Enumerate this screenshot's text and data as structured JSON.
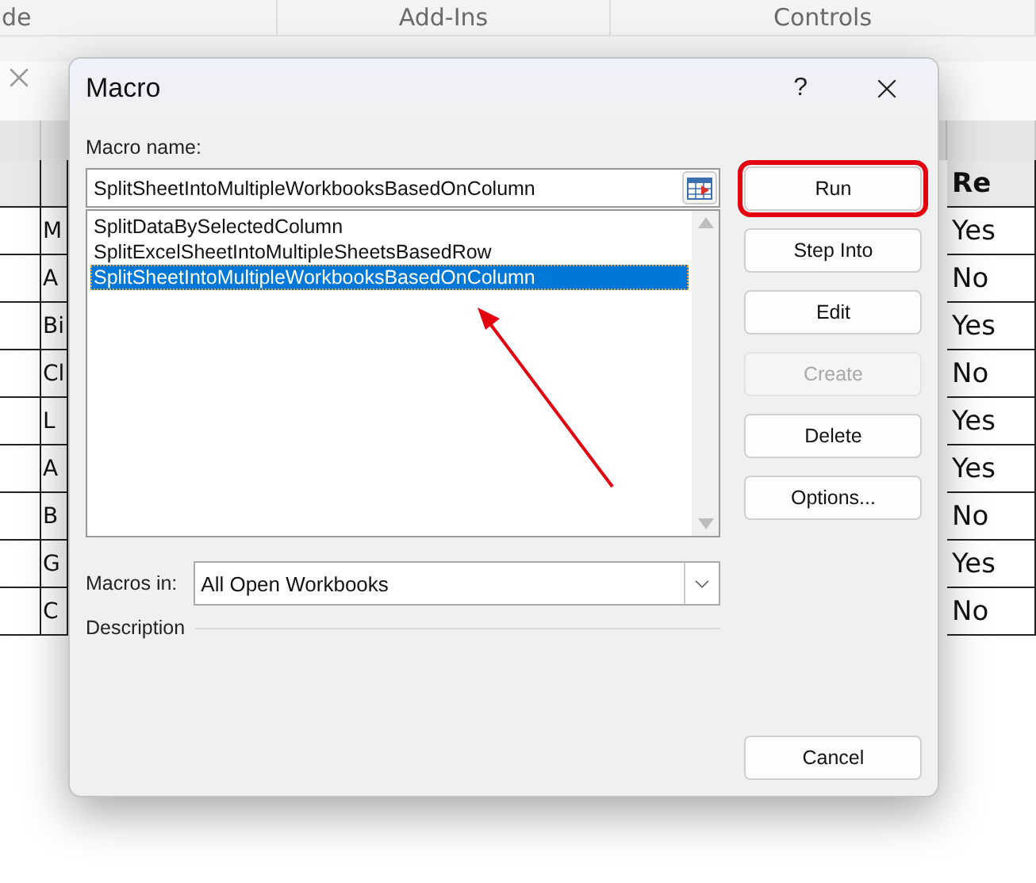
{
  "ribbon": {
    "groups": [
      "de",
      "Add-Ins",
      "Controls"
    ]
  },
  "sheet": {
    "header": {
      "column_2": "Re"
    },
    "rows": [
      {
        "column_1": "M",
        "column_2": "Yes"
      },
      {
        "column_1": "A",
        "column_2": "No"
      },
      {
        "column_1": "Bi",
        "column_2": "Yes"
      },
      {
        "column_1": "Cl",
        "column_2": "No"
      },
      {
        "column_1": "L",
        "column_2": "Yes"
      },
      {
        "column_1": "A",
        "column_2": "Yes"
      },
      {
        "column_1": "B",
        "column_2": "No"
      },
      {
        "column_1": "G",
        "column_2": "Yes"
      },
      {
        "column_1": "C",
        "column_2": "No"
      }
    ]
  },
  "dialog": {
    "title": "Macro",
    "help": "?",
    "macro_name_label": "Macro name:",
    "macro_name_value": "SplitSheetIntoMultipleWorkbooksBasedOnColumn",
    "macros": [
      {
        "name": "SplitDataBySelectedColumn",
        "selected": false
      },
      {
        "name": "SplitExcelSheetIntoMultipleSheetsBasedRow",
        "selected": false
      },
      {
        "name": "SplitSheetIntoMultipleWorkbooksBasedOnColumn",
        "selected": true
      }
    ],
    "macros_in_label": "Macros in:",
    "macros_in_value": "All Open Workbooks",
    "description_label": "Description",
    "buttons": [
      {
        "label": "Run",
        "disabled": false,
        "highlighted": true
      },
      {
        "label": "Step Into",
        "disabled": false,
        "highlighted": false
      },
      {
        "label": "Edit",
        "disabled": false,
        "highlighted": false
      },
      {
        "label": "Create",
        "disabled": true,
        "highlighted": false
      },
      {
        "label": "Delete",
        "disabled": false,
        "highlighted": false
      },
      {
        "label": "Options...",
        "disabled": false,
        "highlighted": false
      }
    ],
    "cancel_button": "Cancel"
  }
}
